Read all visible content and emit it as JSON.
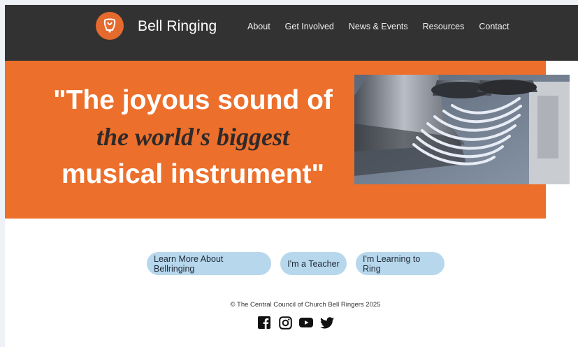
{
  "header": {
    "brand": "Bell Ringing",
    "nav": [
      "About",
      "Get Involved",
      "News & Events",
      "Resources",
      "Contact"
    ]
  },
  "hero": {
    "line1": "\"The joyous sound of",
    "line2": "the world's biggest",
    "line3": "musical instrument\""
  },
  "cta": {
    "learn_more": "Learn More About Bellringing",
    "teacher": "I'm a Teacher",
    "learning": "I'm Learning to Ring"
  },
  "footer": {
    "copyright": "© The Central Council of Church Bell Ringers 2025",
    "social_icons": [
      "facebook-icon",
      "instagram-icon",
      "youtube-icon",
      "twitter-icon"
    ]
  },
  "colors": {
    "nav_bg": "#323232",
    "hero_orange": "#ec6f2c",
    "button_blue": "#b7d7ec"
  }
}
